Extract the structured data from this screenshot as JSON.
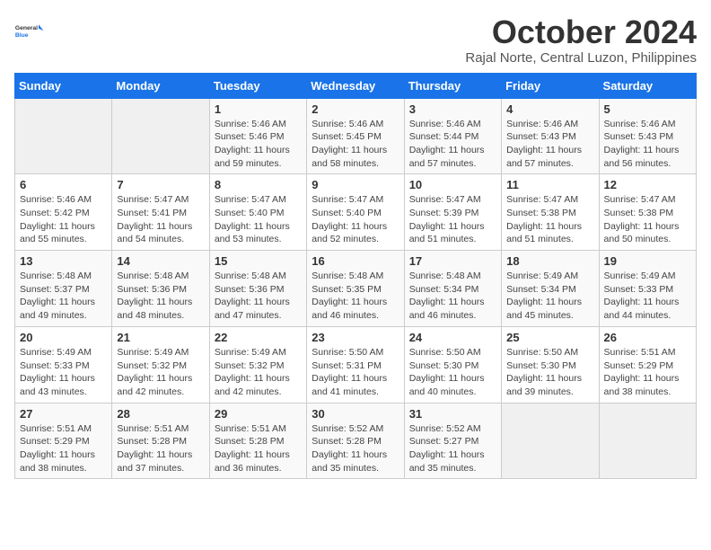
{
  "header": {
    "logo_line1": "General",
    "logo_line2": "Blue",
    "month_title": "October 2024",
    "subtitle": "Rajal Norte, Central Luzon, Philippines"
  },
  "weekdays": [
    "Sunday",
    "Monday",
    "Tuesday",
    "Wednesday",
    "Thursday",
    "Friday",
    "Saturday"
  ],
  "weeks": [
    [
      {
        "day": "",
        "info": ""
      },
      {
        "day": "",
        "info": ""
      },
      {
        "day": "1",
        "info": "Sunrise: 5:46 AM\nSunset: 5:46 PM\nDaylight: 11 hours\nand 59 minutes."
      },
      {
        "day": "2",
        "info": "Sunrise: 5:46 AM\nSunset: 5:45 PM\nDaylight: 11 hours\nand 58 minutes."
      },
      {
        "day": "3",
        "info": "Sunrise: 5:46 AM\nSunset: 5:44 PM\nDaylight: 11 hours\nand 57 minutes."
      },
      {
        "day": "4",
        "info": "Sunrise: 5:46 AM\nSunset: 5:43 PM\nDaylight: 11 hours\nand 57 minutes."
      },
      {
        "day": "5",
        "info": "Sunrise: 5:46 AM\nSunset: 5:43 PM\nDaylight: 11 hours\nand 56 minutes."
      }
    ],
    [
      {
        "day": "6",
        "info": "Sunrise: 5:46 AM\nSunset: 5:42 PM\nDaylight: 11 hours\nand 55 minutes."
      },
      {
        "day": "7",
        "info": "Sunrise: 5:47 AM\nSunset: 5:41 PM\nDaylight: 11 hours\nand 54 minutes."
      },
      {
        "day": "8",
        "info": "Sunrise: 5:47 AM\nSunset: 5:40 PM\nDaylight: 11 hours\nand 53 minutes."
      },
      {
        "day": "9",
        "info": "Sunrise: 5:47 AM\nSunset: 5:40 PM\nDaylight: 11 hours\nand 52 minutes."
      },
      {
        "day": "10",
        "info": "Sunrise: 5:47 AM\nSunset: 5:39 PM\nDaylight: 11 hours\nand 51 minutes."
      },
      {
        "day": "11",
        "info": "Sunrise: 5:47 AM\nSunset: 5:38 PM\nDaylight: 11 hours\nand 51 minutes."
      },
      {
        "day": "12",
        "info": "Sunrise: 5:47 AM\nSunset: 5:38 PM\nDaylight: 11 hours\nand 50 minutes."
      }
    ],
    [
      {
        "day": "13",
        "info": "Sunrise: 5:48 AM\nSunset: 5:37 PM\nDaylight: 11 hours\nand 49 minutes."
      },
      {
        "day": "14",
        "info": "Sunrise: 5:48 AM\nSunset: 5:36 PM\nDaylight: 11 hours\nand 48 minutes."
      },
      {
        "day": "15",
        "info": "Sunrise: 5:48 AM\nSunset: 5:36 PM\nDaylight: 11 hours\nand 47 minutes."
      },
      {
        "day": "16",
        "info": "Sunrise: 5:48 AM\nSunset: 5:35 PM\nDaylight: 11 hours\nand 46 minutes."
      },
      {
        "day": "17",
        "info": "Sunrise: 5:48 AM\nSunset: 5:34 PM\nDaylight: 11 hours\nand 46 minutes."
      },
      {
        "day": "18",
        "info": "Sunrise: 5:49 AM\nSunset: 5:34 PM\nDaylight: 11 hours\nand 45 minutes."
      },
      {
        "day": "19",
        "info": "Sunrise: 5:49 AM\nSunset: 5:33 PM\nDaylight: 11 hours\nand 44 minutes."
      }
    ],
    [
      {
        "day": "20",
        "info": "Sunrise: 5:49 AM\nSunset: 5:33 PM\nDaylight: 11 hours\nand 43 minutes."
      },
      {
        "day": "21",
        "info": "Sunrise: 5:49 AM\nSunset: 5:32 PM\nDaylight: 11 hours\nand 42 minutes."
      },
      {
        "day": "22",
        "info": "Sunrise: 5:49 AM\nSunset: 5:32 PM\nDaylight: 11 hours\nand 42 minutes."
      },
      {
        "day": "23",
        "info": "Sunrise: 5:50 AM\nSunset: 5:31 PM\nDaylight: 11 hours\nand 41 minutes."
      },
      {
        "day": "24",
        "info": "Sunrise: 5:50 AM\nSunset: 5:30 PM\nDaylight: 11 hours\nand 40 minutes."
      },
      {
        "day": "25",
        "info": "Sunrise: 5:50 AM\nSunset: 5:30 PM\nDaylight: 11 hours\nand 39 minutes."
      },
      {
        "day": "26",
        "info": "Sunrise: 5:51 AM\nSunset: 5:29 PM\nDaylight: 11 hours\nand 38 minutes."
      }
    ],
    [
      {
        "day": "27",
        "info": "Sunrise: 5:51 AM\nSunset: 5:29 PM\nDaylight: 11 hours\nand 38 minutes."
      },
      {
        "day": "28",
        "info": "Sunrise: 5:51 AM\nSunset: 5:28 PM\nDaylight: 11 hours\nand 37 minutes."
      },
      {
        "day": "29",
        "info": "Sunrise: 5:51 AM\nSunset: 5:28 PM\nDaylight: 11 hours\nand 36 minutes."
      },
      {
        "day": "30",
        "info": "Sunrise: 5:52 AM\nSunset: 5:28 PM\nDaylight: 11 hours\nand 35 minutes."
      },
      {
        "day": "31",
        "info": "Sunrise: 5:52 AM\nSunset: 5:27 PM\nDaylight: 11 hours\nand 35 minutes."
      },
      {
        "day": "",
        "info": ""
      },
      {
        "day": "",
        "info": ""
      }
    ]
  ]
}
